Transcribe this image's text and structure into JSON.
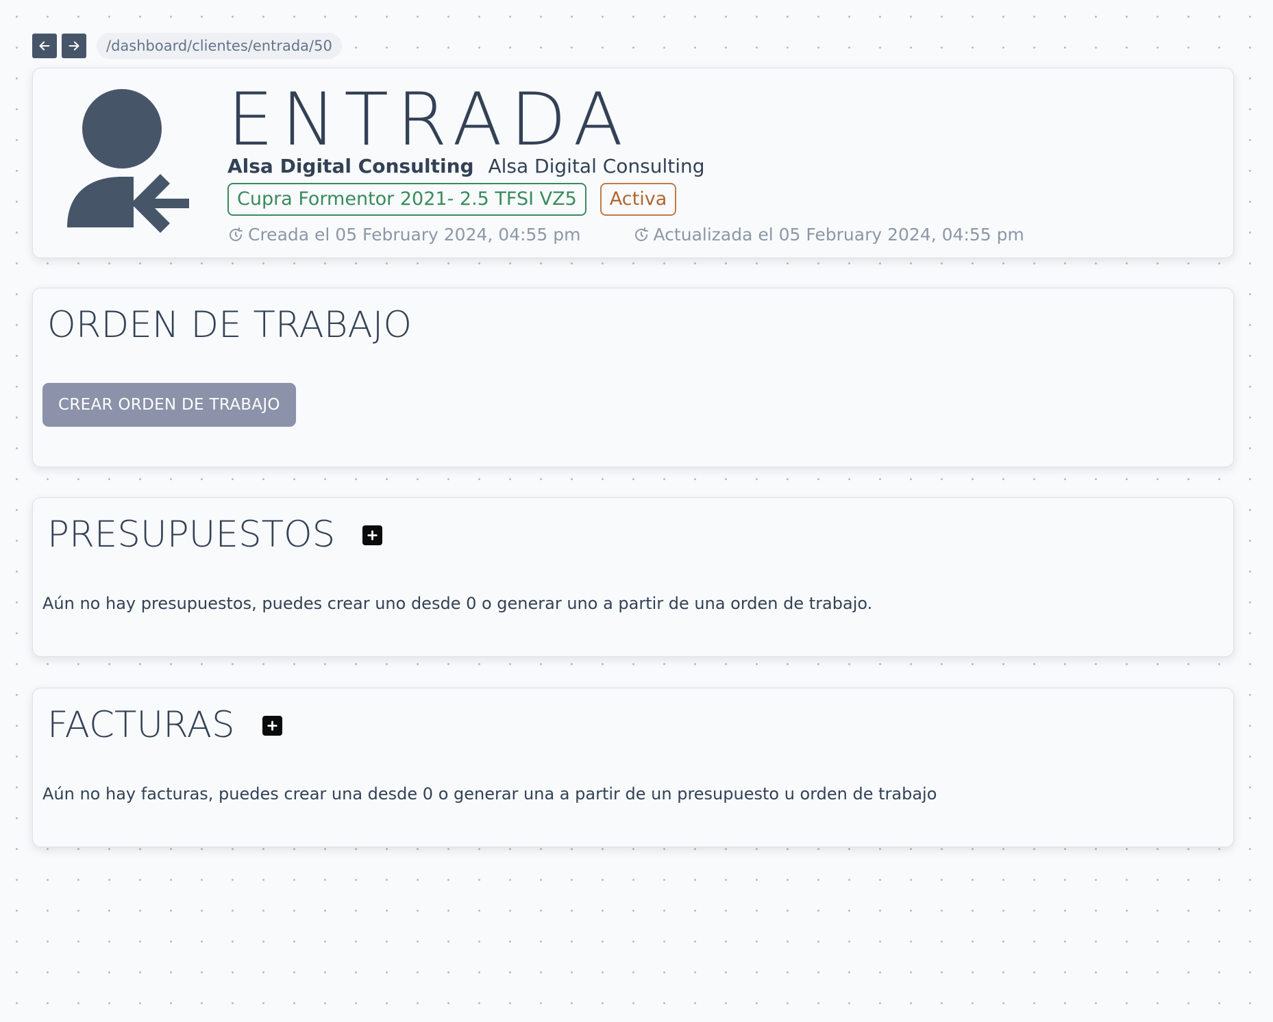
{
  "nav": {
    "back_icon": "arrow-left-icon",
    "forward_icon": "arrow-right-icon",
    "path": "/dashboard/clientes/entrada/50"
  },
  "header": {
    "icon": "user-entry-arrow-icon",
    "title": "ENTRADA",
    "client_name_bold": "Alsa Digital Consulting",
    "client_name": "Alsa Digital Consulting",
    "vehicle_tag": "Cupra Formentor 2021- 2.5 TFSI VZ5",
    "status_tag": "Activa",
    "created_label": "Creada el 05 February 2024, 04:55 pm",
    "updated_label": "Actualizada el 05 February 2024, 04:55 pm"
  },
  "orden": {
    "title": "ORDEN DE TRABAJO",
    "create_button": "CREAR ORDEN DE TRABAJO"
  },
  "presupuestos": {
    "title": "PRESUPUESTOS",
    "add_icon": "plus-square-icon",
    "empty_text": "Aún no hay presupuestos, puedes crear uno desde 0 o generar uno a partir de una orden de trabajo."
  },
  "facturas": {
    "title": "FACTURAS",
    "add_icon": "plus-square-icon",
    "empty_text": "Aún no hay facturas, puedes crear una desde 0 o generar una a partir de un presupuesto u orden de trabajo"
  },
  "colors": {
    "dark_slate": "#334155",
    "nav_button": "#475569",
    "vehicle_tag": "#3a8a5c",
    "status_tag": "#b0672d",
    "create_button": "#8b92a9",
    "muted_text": "#8d97a6"
  }
}
